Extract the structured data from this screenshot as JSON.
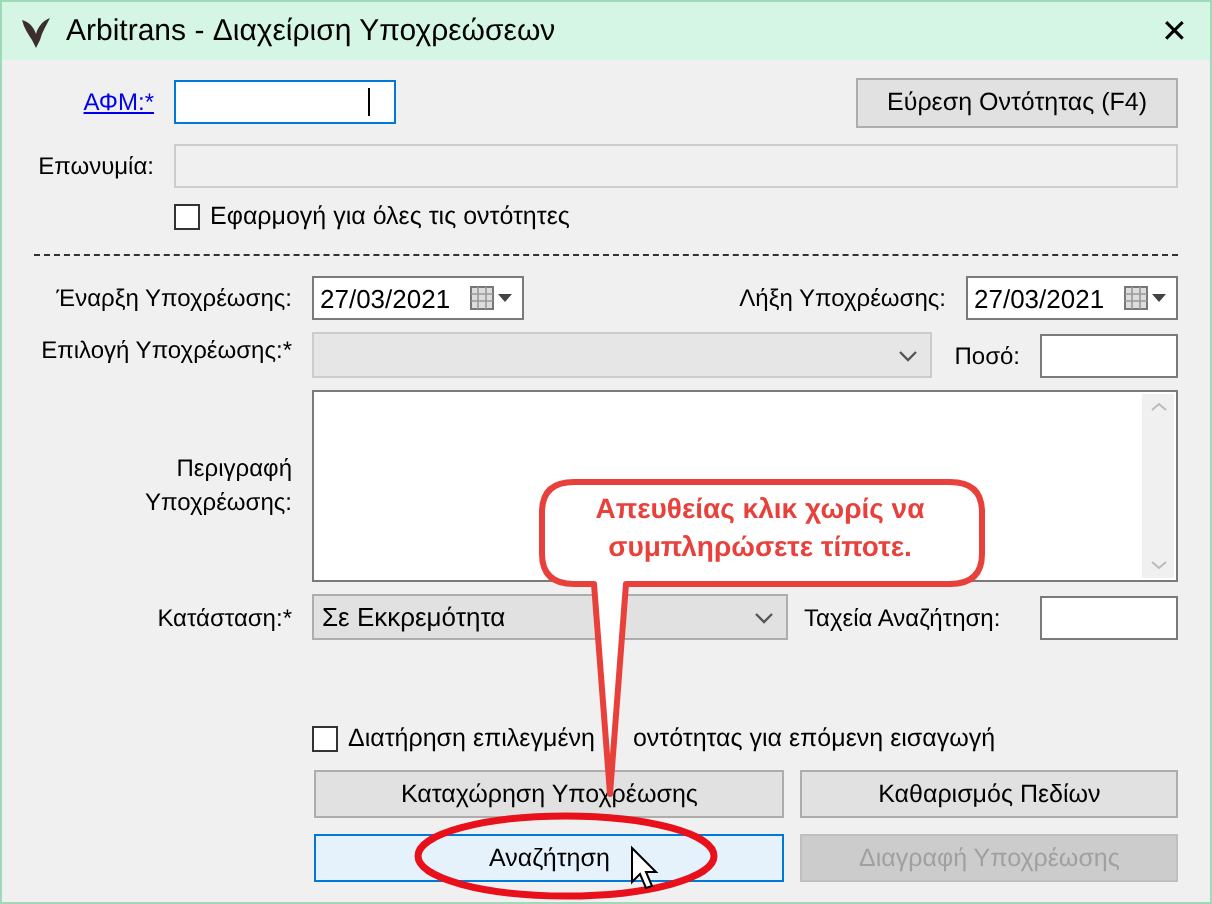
{
  "window": {
    "title": "Arbitrans - Διαχείριση Υποχρεώσεων",
    "close": "✕"
  },
  "tax_id": {
    "label": "ΑΦΜ:*",
    "focused": true
  },
  "find_button": {
    "label": "Εύρεση Οντότητας (F4)"
  },
  "name": {
    "label": "Επωνυμία:",
    "disabled": true
  },
  "apply_all": {
    "label": "Εφαρμογή για όλες τις οντότητες",
    "checked": false
  },
  "start_date": {
    "label": "Έναρξη Υποχρέωσης:",
    "value": "27/03/2021"
  },
  "end_date": {
    "label": "Λήξη Υποχρέωσης:",
    "value": "27/03/2021"
  },
  "obligation": {
    "label": "Επιλογή Υποχρέωσης:*",
    "disabled": true
  },
  "amount": {
    "label": "Ποσό:"
  },
  "description": {
    "label": "Περιγραφή Υποχρέωσης:"
  },
  "status": {
    "label": "Κατάσταση:*",
    "value": "Σε Εκκρεμότητα",
    "disabled": false
  },
  "quick_search": {
    "label": "Ταχεία Αναζήτηση:"
  },
  "keep_entity": {
    "label_parts": [
      "Διατήρηση επιλεγμένη",
      "οντότητας για επόμενη εισαγωγή"
    ],
    "checked": false
  },
  "buttons": [
    {
      "label": "Καταχώρηση Υποχρέωσης",
      "disabled": false,
      "highlighted": false
    },
    {
      "label": "Καθαρισμός Πεδίων",
      "disabled": false,
      "highlighted": false
    },
    {
      "label": "Αναζήτηση",
      "disabled": false,
      "highlighted": true
    },
    {
      "label": "Διαγραφή Υποχρέωσης",
      "disabled": true,
      "highlighted": false
    }
  ],
  "callout": {
    "text": "Απευθείας κλικ χωρίς να συμπληρώσετε τίποτε."
  }
}
